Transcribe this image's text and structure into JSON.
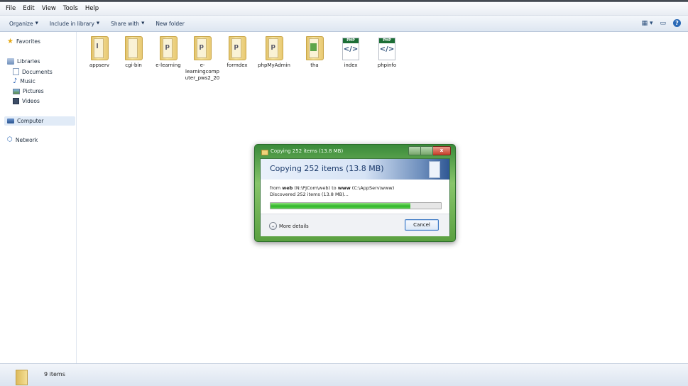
{
  "menu": [
    "File",
    "Edit",
    "View",
    "Tools",
    "Help"
  ],
  "toolbar": {
    "organize": "Organize",
    "include_in_library": "Include in library",
    "share_with": "Share with",
    "new_folder": "New folder"
  },
  "nav": {
    "favorites": "Favorites",
    "libraries": "Libraries",
    "documents": "Documents",
    "music": "Music",
    "pictures": "Pictures",
    "videos": "Videos",
    "computer": "Computer",
    "network": "Network"
  },
  "files": [
    {
      "name": "appserv",
      "type": "folder"
    },
    {
      "name": "cgi-bin",
      "type": "folder"
    },
    {
      "name": "e-learning",
      "type": "folder"
    },
    {
      "name": "e-learningcomputer_pws2_20",
      "type": "folder"
    },
    {
      "name": "formdex",
      "type": "folder"
    },
    {
      "name": "phpMyAdmin",
      "type": "folder"
    },
    {
      "name": "tha",
      "type": "folder"
    },
    {
      "name": "index",
      "type": "php"
    },
    {
      "name": "phpinfo",
      "type": "php"
    }
  ],
  "status": {
    "count": "9 items"
  },
  "dialog": {
    "title": "Copying 252 items (13.8 MB)",
    "heading": "Copying 252 items (13.8 MB)",
    "from_prefix": "from",
    "source": "web",
    "source_path": "(N:\\PJCom\\web)",
    "to_word": "to",
    "dest": "www",
    "dest_path": "(C:\\AppServ\\www)",
    "discovered": "Discovered 252 items (13.8 MB)...",
    "progress": 0.82,
    "more_details": "More details",
    "cancel": "Cancel",
    "close_glyph": "x"
  }
}
